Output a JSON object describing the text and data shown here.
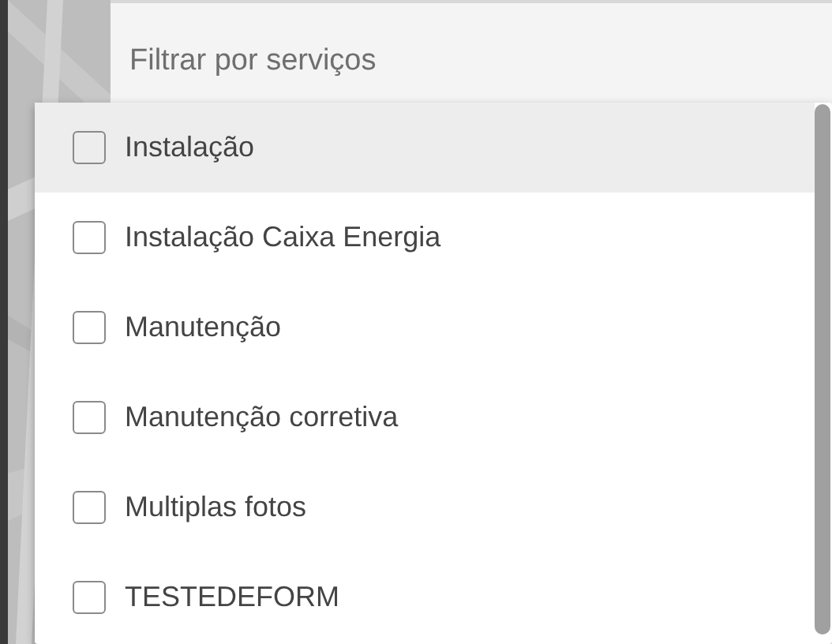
{
  "filter": {
    "label": "Filtrar por serviços"
  },
  "dropdown": {
    "options": [
      {
        "label": "Instalação",
        "checked": false,
        "selected": true
      },
      {
        "label": "Instalação Caixa Energia",
        "checked": false,
        "selected": false
      },
      {
        "label": "Manutenção",
        "checked": false,
        "selected": false
      },
      {
        "label": "Manutenção corretiva",
        "checked": false,
        "selected": false
      },
      {
        "label": "Multiplas fotos",
        "checked": false,
        "selected": false
      },
      {
        "label": "TESTEDEFORM",
        "checked": false,
        "selected": false
      }
    ]
  }
}
